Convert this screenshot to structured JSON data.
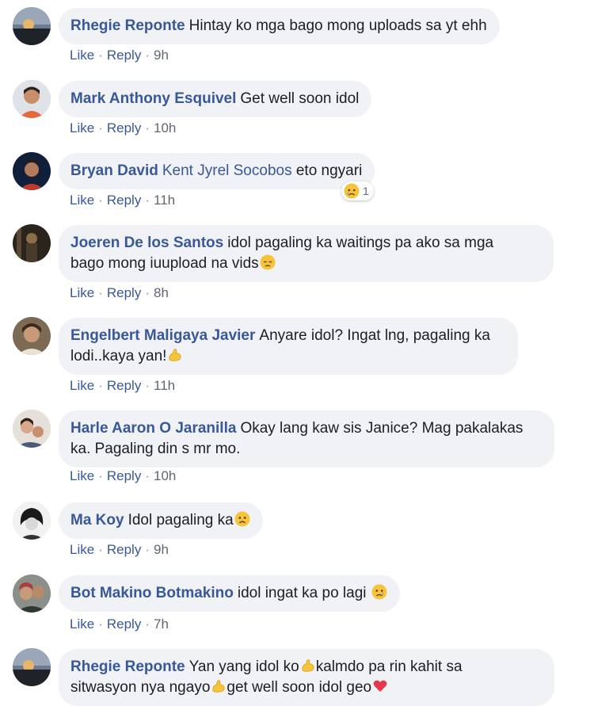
{
  "comments": [
    {
      "author": "Rhegie Reponte",
      "text": "Hintay ko mga bago mong uploads sa yt ehh",
      "like": "Like",
      "reply": "Reply",
      "time": "9h"
    },
    {
      "author": "Mark Anthony Esquivel",
      "text": "Get well soon idol",
      "like": "Like",
      "reply": "Reply",
      "time": "10h"
    },
    {
      "author": "Bryan David",
      "mention": "Kent Jyrel Socobos",
      "text": "eto ngyari",
      "like": "Like",
      "reply": "Reply",
      "time": "11h",
      "reaction_count": "1",
      "reaction_icon": "sad-reaction-icon"
    },
    {
      "author": "Joeren De los Santos",
      "text_line1": "idol pagaling ka waitings pa ako sa mga",
      "text_line2": "bago mong iuupload na vids",
      "like": "Like",
      "reply": "Reply",
      "time": "8h"
    },
    {
      "author": "Engelbert Maligaya Javier",
      "text_line1": "Anyare idol? Ingat lng, pagaling ka",
      "text_line2": "lodi..kaya yan!",
      "like": "Like",
      "reply": "Reply",
      "time": "11h"
    },
    {
      "author": "Harle Aaron O Jaranilla",
      "text_line1": "Okay lang kaw sis Janice? Mag pakalakas",
      "text_line2": "ka. Pagaling din s mr mo.",
      "like": "Like",
      "reply": "Reply",
      "time": "10h"
    },
    {
      "author": "Ma Koy",
      "text": "Idol pagaling ka",
      "like": "Like",
      "reply": "Reply",
      "time": "9h"
    },
    {
      "author": "Bot Makino Botmakino",
      "text": "idol ingat ka po lagi",
      "like": "Like",
      "reply": "Reply",
      "time": "7h"
    },
    {
      "author": "Rhegie Reponte",
      "text_line1a": "Yan yang idol ko",
      "text_line1b": "kalmdo pa rin kahit sa",
      "text_line2a": "sitwasyon nya ngayo",
      "text_line2b": "get well soon idol geo"
    }
  ],
  "colors": {
    "bubble": "#f0f2f5",
    "author": "#385898",
    "meta": "#616770"
  }
}
